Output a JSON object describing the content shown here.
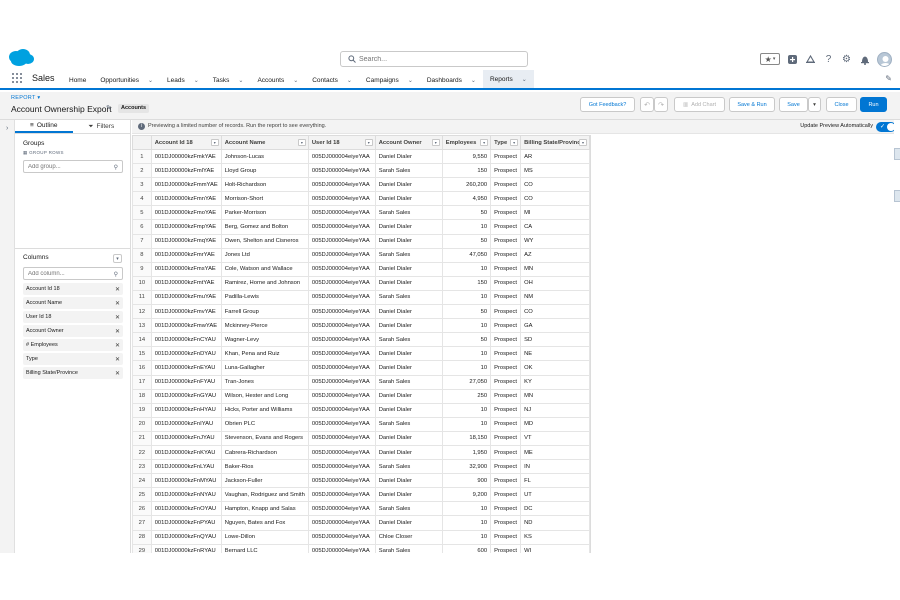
{
  "global_header": {
    "search_placeholder": "Search...",
    "icons": [
      "favorites-star-icon",
      "chevron-down-icon",
      "add-icon",
      "help-icon",
      "setup-gear-icon",
      "notification-bell-icon",
      "avatar"
    ]
  },
  "nav": {
    "app_name": "Sales",
    "items": [
      {
        "label": "Home",
        "has_menu": false
      },
      {
        "label": "Opportunities",
        "has_menu": true
      },
      {
        "label": "Leads",
        "has_menu": true
      },
      {
        "label": "Tasks",
        "has_menu": true
      },
      {
        "label": "Accounts",
        "has_menu": true
      },
      {
        "label": "Contacts",
        "has_menu": true
      },
      {
        "label": "Campaigns",
        "has_menu": true
      },
      {
        "label": "Dashboards",
        "has_menu": true
      },
      {
        "label": "Reports",
        "has_menu": true,
        "active": true
      }
    ]
  },
  "report": {
    "eyebrow": "REPORT",
    "title": "Account Ownership Export",
    "type_badge": "Accounts",
    "buttons": {
      "feedback": "Got Feedback?",
      "add_chart": "Add Chart",
      "save_run": "Save & Run",
      "save": "Save",
      "close": "Close",
      "run": "Run"
    }
  },
  "side_panel": {
    "tabs": {
      "outline": "Outline",
      "filters": "Filters"
    },
    "groups_title": "Groups",
    "group_rows_label": "GROUP ROWS",
    "add_group_placeholder": "Add group...",
    "columns_title": "Columns",
    "add_column_placeholder": "Add column...",
    "columns": [
      "Account Id 18",
      "Account Name",
      "User Id 18",
      "Account Owner",
      "# Employees",
      "Type",
      "Billing State/Province"
    ]
  },
  "preview": {
    "notice": "Previewing a limited number of records. Run the report to see everything.",
    "auto_label": "Update Preview Automatically",
    "auto_on": true
  },
  "table": {
    "headers": [
      "Account Id 18",
      "Account Name",
      "User Id 18",
      "Account Owner",
      "Employees",
      "Type",
      "Billing State/Province"
    ],
    "rows": [
      [
        "1",
        "001DJ00000kzFmkYAE",
        "Johnson-Lucas",
        "005DJ000004eiyeYAA",
        "Daniel Dialer",
        "9,550",
        "Prospect",
        "AR"
      ],
      [
        "2",
        "001DJ00000kzFmlYAE",
        "Lloyd Group",
        "005DJ000004eiyeYAA",
        "Sarah Sales",
        "150",
        "Prospect",
        "MS"
      ],
      [
        "3",
        "001DJ00000kzFmmYAE",
        "Holt-Richardson",
        "005DJ000004eiyeYAA",
        "Daniel Dialer",
        "260,200",
        "Prospect",
        "CO"
      ],
      [
        "4",
        "001DJ00000kzFmnYAE",
        "Morrison-Short",
        "005DJ000004eiyeYAA",
        "Daniel Dialer",
        "4,950",
        "Prospect",
        "CO"
      ],
      [
        "5",
        "001DJ00000kzFmoYAE",
        "Parker-Morrison",
        "005DJ000004eiyeYAA",
        "Sarah Sales",
        "50",
        "Prospect",
        "MI"
      ],
      [
        "6",
        "001DJ00000kzFmpYAE",
        "Berg, Gomez and Bolton",
        "005DJ000004eiyeYAA",
        "Daniel Dialer",
        "10",
        "Prospect",
        "CA"
      ],
      [
        "7",
        "001DJ00000kzFmqYAE",
        "Owen, Shelton and Cisneros",
        "005DJ000004eiyeYAA",
        "Daniel Dialer",
        "50",
        "Prospect",
        "WY"
      ],
      [
        "8",
        "001DJ00000kzFmrYAE",
        "Jones Ltd",
        "005DJ000004eiyeYAA",
        "Sarah Sales",
        "47,050",
        "Prospect",
        "AZ"
      ],
      [
        "9",
        "001DJ00000kzFmsYAE",
        "Cole, Watson and Wallace",
        "005DJ000004eiyeYAA",
        "Daniel Dialer",
        "10",
        "Prospect",
        "MN"
      ],
      [
        "10",
        "001DJ00000kzFmtYAE",
        "Ramirez, Horne and Johnson",
        "005DJ000004eiyeYAA",
        "Daniel Dialer",
        "150",
        "Prospect",
        "OH"
      ],
      [
        "11",
        "001DJ00000kzFmuYAE",
        "Padilla-Lewis",
        "005DJ000004eiyeYAA",
        "Sarah Sales",
        "10",
        "Prospect",
        "NM"
      ],
      [
        "12",
        "001DJ00000kzFmvYAE",
        "Farrell Group",
        "005DJ000004eiyeYAA",
        "Daniel Dialer",
        "50",
        "Prospect",
        "CO"
      ],
      [
        "13",
        "001DJ00000kzFmwYAE",
        "Mckinney-Pierce",
        "005DJ000004eiyeYAA",
        "Daniel Dialer",
        "10",
        "Prospect",
        "GA"
      ],
      [
        "14",
        "001DJ00000kzFnCYAU",
        "Wagner-Levy",
        "005DJ000004eiyeYAA",
        "Sarah Sales",
        "50",
        "Prospect",
        "SD"
      ],
      [
        "15",
        "001DJ00000kzFnDYAU",
        "Khan, Pena and Ruiz",
        "005DJ000004eiyeYAA",
        "Daniel Dialer",
        "10",
        "Prospect",
        "NE"
      ],
      [
        "16",
        "001DJ00000kzFnEYAU",
        "Luna-Gallagher",
        "005DJ000004eiyeYAA",
        "Daniel Dialer",
        "10",
        "Prospect",
        "OK"
      ],
      [
        "17",
        "001DJ00000kzFnFYAU",
        "Tran-Jones",
        "005DJ000004eiyeYAA",
        "Sarah Sales",
        "27,050",
        "Prospect",
        "KY"
      ],
      [
        "18",
        "001DJ00000kzFnGYAU",
        "Wilson, Hester and Long",
        "005DJ000004eiyeYAA",
        "Daniel Dialer",
        "250",
        "Prospect",
        "MN"
      ],
      [
        "19",
        "001DJ00000kzFnHYAU",
        "Hicks, Porter and Williams",
        "005DJ000004eiyeYAA",
        "Daniel Dialer",
        "10",
        "Prospect",
        "NJ"
      ],
      [
        "20",
        "001DJ00000kzFnIYAU",
        "Obrien PLC",
        "005DJ000004eiyeYAA",
        "Sarah Sales",
        "10",
        "Prospect",
        "MD"
      ],
      [
        "21",
        "001DJ00000kzFnJYAU",
        "Stevenson, Evans and Rogers",
        "005DJ000004eiyeYAA",
        "Daniel Dialer",
        "18,150",
        "Prospect",
        "VT"
      ],
      [
        "22",
        "001DJ00000kzFnKYAU",
        "Cabrera-Richardson",
        "005DJ000004eiyeYAA",
        "Daniel Dialer",
        "1,950",
        "Prospect",
        "ME"
      ],
      [
        "23",
        "001DJ00000kzFnLYAU",
        "Baker-Rios",
        "005DJ000004eiyeYAA",
        "Sarah Sales",
        "32,900",
        "Prospect",
        "IN"
      ],
      [
        "24",
        "001DJ00000kzFnMYAU",
        "Jackson-Fuller",
        "005DJ000004eiyeYAA",
        "Daniel Dialer",
        "900",
        "Prospect",
        "FL"
      ],
      [
        "25",
        "001DJ00000kzFnNYAU",
        "Vaughan, Rodriguez and Smith",
        "005DJ000004eiyeYAA",
        "Daniel Dialer",
        "9,200",
        "Prospect",
        "UT"
      ],
      [
        "26",
        "001DJ00000kzFnOYAU",
        "Hampton, Knapp and Salas",
        "005DJ000004eiyeYAA",
        "Sarah Sales",
        "10",
        "Prospect",
        "DC"
      ],
      [
        "27",
        "001DJ00000kzFnPYAU",
        "Nguyen, Bates and Fox",
        "005DJ000004eiyeYAA",
        "Daniel Dialer",
        "10",
        "Prospect",
        "ND"
      ],
      [
        "28",
        "001DJ00000kzFnQYAU",
        "Lowe-Dillon",
        "005DJ000004eiyeYAA",
        "Chloe Closer",
        "10",
        "Prospect",
        "KS"
      ],
      [
        "29",
        "001DJ00000kzFnRYAU",
        "Bernard LLC",
        "005DJ000004eiyeYAA",
        "Sarah Sales",
        "600",
        "Prospect",
        "WI"
      ]
    ]
  },
  "colors": {
    "brand": "#0176d3",
    "cloud": "#00a1e0",
    "panel_bg": "#f3f3f3"
  }
}
